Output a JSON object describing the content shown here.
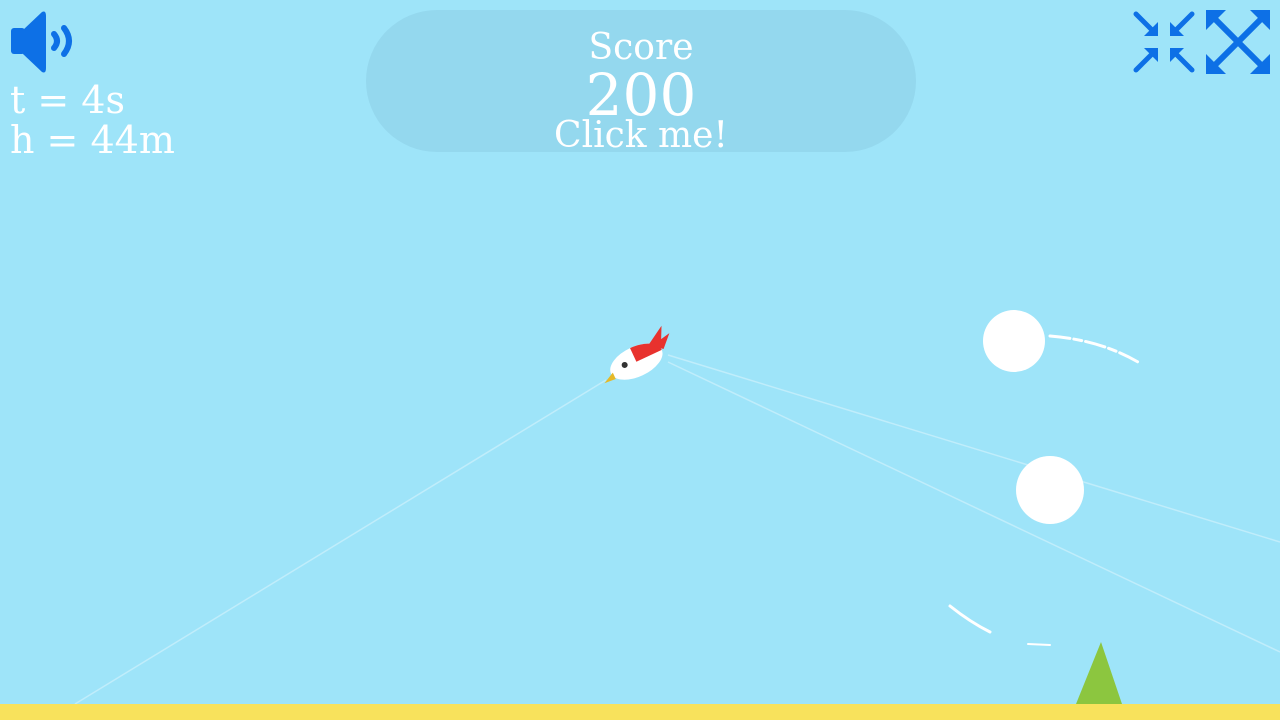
{
  "hud": {
    "time_text": "t = 4s",
    "height_text": "h = 44m"
  },
  "score_panel": {
    "label": "Score",
    "value": "200",
    "cta": "Click me!"
  },
  "icons": {
    "sound": "speaker-volume-icon",
    "shrink": "exit-fullscreen-icon",
    "close": "close-icon"
  },
  "colors": {
    "sky": "#9ee4f9",
    "ground": "#f8e25c",
    "icon_blue": "#0d70e6",
    "bird_red": "#e8322e",
    "tree_green": "#8cc63f",
    "white": "#ffffff"
  }
}
